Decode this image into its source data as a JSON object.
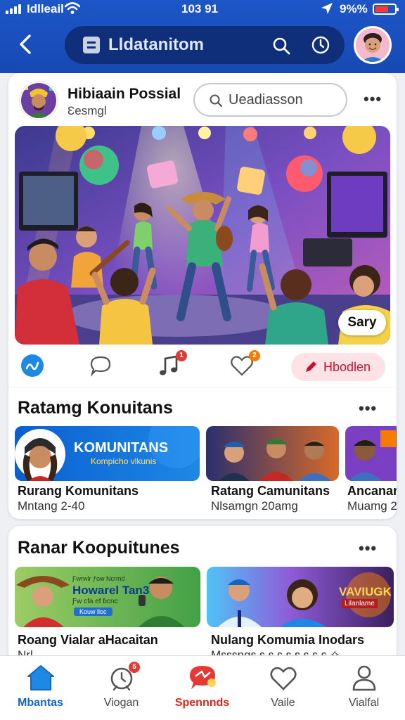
{
  "status_bar": {
    "carrier": "Idlleail",
    "time": "103 91",
    "battery_text": "9%%"
  },
  "header": {
    "back_icon": "chevron-left-icon",
    "search_title": "Lldatanitom",
    "colors": {
      "bar": "#1d56c7",
      "pill": "#0f2f7a"
    }
  },
  "post": {
    "author_name": "Hibiaain Possial",
    "author_sub": "Ɛesmgl",
    "search_value": "Ueadiasson",
    "more_label": "•••",
    "image_badge": "Sary",
    "action_badges": {
      "music": "1",
      "heart": "2"
    },
    "highlight_button": "Hbodlen",
    "accent": "#c8102e"
  },
  "section1": {
    "title": "Ratamg Konuitans",
    "more_label": "•••",
    "banner_title": "KOMUNITANS",
    "banner_sub": "Kompicho vlkunis",
    "items": [
      {
        "name": "Rurang Komunitans",
        "sub": "Mntang 2-40"
      },
      {
        "name": "Ratang Camunitans",
        "sub": "Nlsamgn 20amg"
      },
      {
        "name": "Ancanar",
        "sub": "Muamg 2"
      }
    ]
  },
  "section2": {
    "title": "Ranar Koopuitunes",
    "more_label": "•••",
    "banner1_kicker": "Ƒwrwlr ƒow Ncrmd",
    "banner1_title": "Howarel Tan3",
    "banner1_sub": "Ƒw cfa ef ɓcnc",
    "banner1_tag": "Kouw lloc",
    "banner2_title": "VAVIUGK",
    "banner2_sub": "Lilanlame",
    "items": [
      {
        "name": "Roang Vialar aHacaitan",
        "sub": "Nrl..."
      },
      {
        "name": "Nulang Komumia Inodars",
        "sub": "Mɛɛɛngɛ ɛ ɛ ɛ ɛ ɛ ɛ ɛ ɛ ✧"
      }
    ]
  },
  "bottom_nav": [
    {
      "label": "Mbantas",
      "icon": "home-icon",
      "active": true,
      "color": "#1565c0"
    },
    {
      "label": "Viogan",
      "icon": "timer-icon",
      "badge": "5"
    },
    {
      "label": "Spennnds",
      "icon": "chat-bubble-icon",
      "color": "#d9251c"
    },
    {
      "label": "Vaile",
      "icon": "heart-icon"
    },
    {
      "label": "Vialfal",
      "icon": "person-icon"
    }
  ]
}
